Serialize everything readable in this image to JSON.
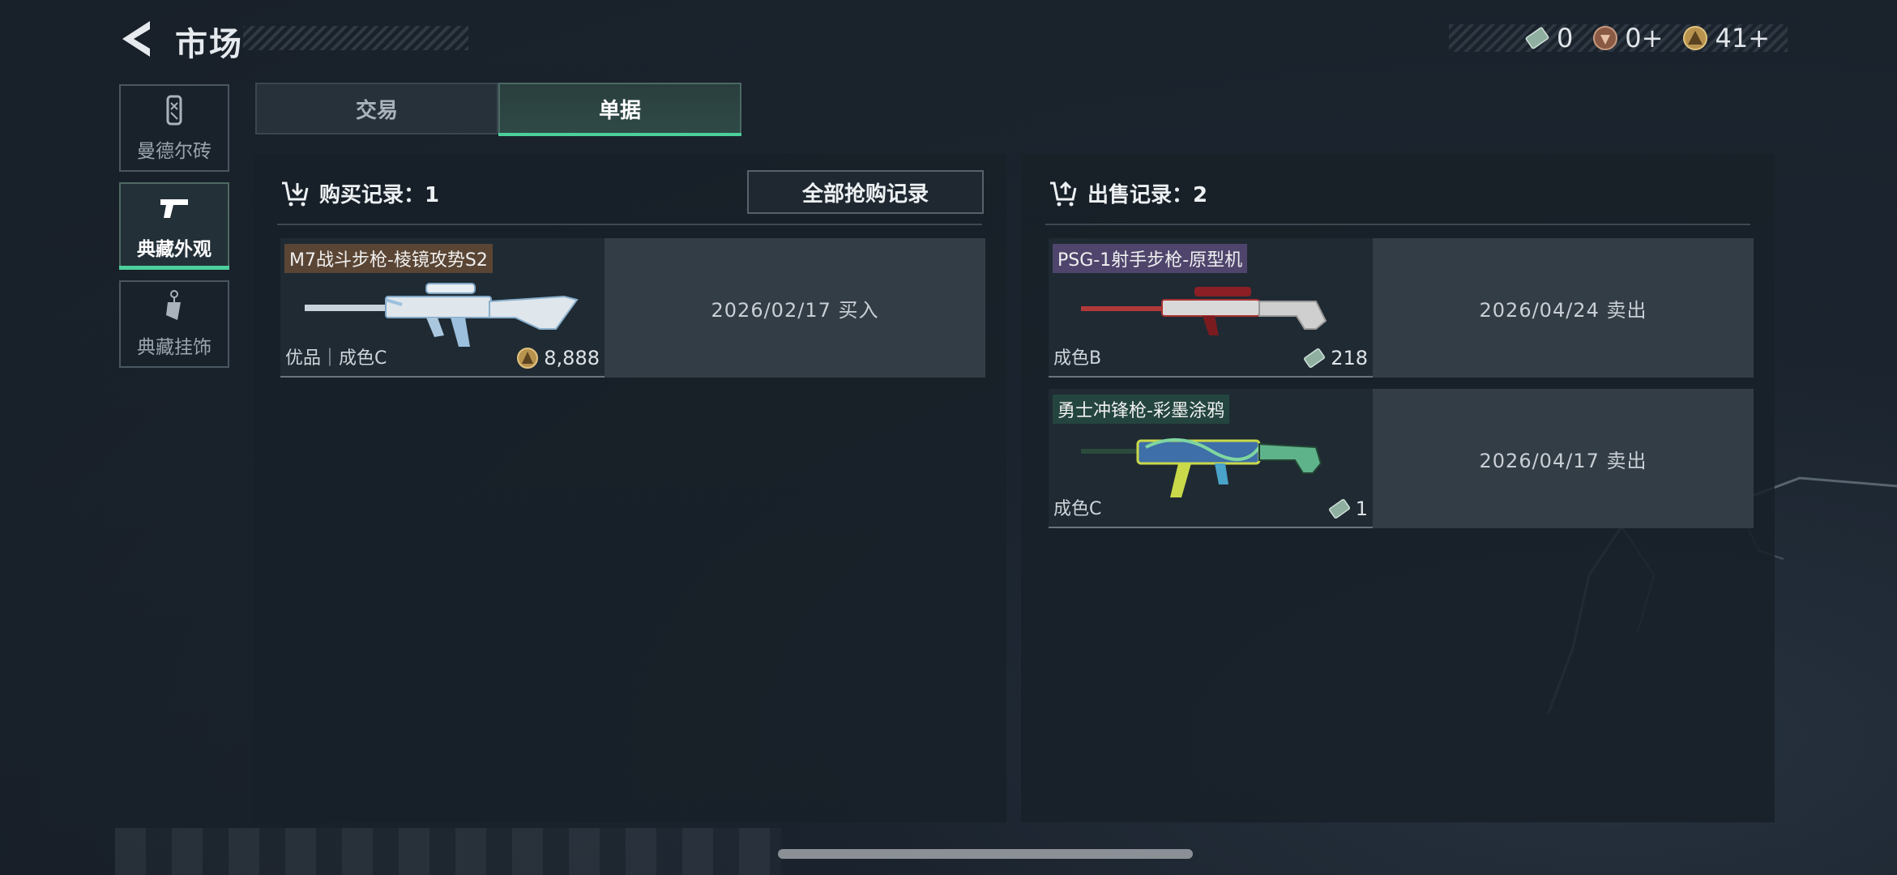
{
  "header": {
    "title": "市场"
  },
  "currency": [
    {
      "icon": "ticket-icon",
      "value": "0"
    },
    {
      "icon": "bronze-medal-icon",
      "value": "0+"
    },
    {
      "icon": "gold-coin-icon",
      "value": "41+"
    }
  ],
  "sidebar": {
    "items": [
      {
        "label": "曼德尔砖",
        "icon": "brick-icon"
      },
      {
        "label": "典藏外观",
        "icon": "pistol-icon"
      },
      {
        "label": "典藏挂饰",
        "icon": "charm-icon"
      }
    ]
  },
  "tabs": [
    {
      "label": "交易"
    },
    {
      "label": "单据"
    }
  ],
  "purchase": {
    "title": "购买记录：1",
    "all_button": "全部抢购记录",
    "records": [
      {
        "name": "M7战斗步枪-棱镜攻势S2",
        "condition": "优品｜成色C",
        "price": "8,888",
        "currency_icon": "gold-coin-icon",
        "date_text": "2026/02/17 买入"
      }
    ]
  },
  "sales": {
    "title": "出售记录：2",
    "records": [
      {
        "name": "PSG-1射手步枪-原型机",
        "condition": "成色B",
        "price": "218",
        "currency_icon": "ticket-icon",
        "date_text": "2026/04/24 卖出"
      },
      {
        "name": "勇士冲锋枪-彩墨涂鸦",
        "condition": "成色C",
        "price": "1",
        "currency_icon": "ticket-icon",
        "date_text": "2026/04/17 卖出"
      }
    ]
  },
  "colors": {
    "accent": "#4ccf9c",
    "panel": "#182028",
    "date_box": "#333d46"
  }
}
